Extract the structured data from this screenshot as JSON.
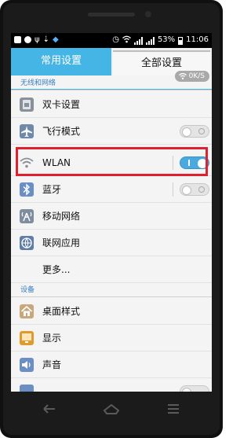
{
  "status_bar": {
    "battery": "53%",
    "time": "11:06",
    "left_icons": [
      "message-icon",
      "camera-icon",
      "usb-icon",
      "download-icon",
      "shield-icon"
    ],
    "right_icons": [
      "alarm-icon",
      "wifi-icon",
      "signal-icon",
      "signal-icon",
      "battery-icon"
    ]
  },
  "tabs": [
    {
      "label": "常用设置",
      "active": true
    },
    {
      "label": "全部设置",
      "active": false
    }
  ],
  "speed_badge": "0K/S",
  "sections": {
    "wireless": "无线和网络",
    "device": "设备"
  },
  "rows": {
    "dual_sim": {
      "label": "双卡设置",
      "icon": "sim-card-icon"
    },
    "airplane": {
      "label": "飞行模式",
      "icon": "airplane-icon",
      "toggle": false
    },
    "wlan": {
      "label": "WLAN",
      "icon": "wifi-icon",
      "toggle": true
    },
    "bluetooth": {
      "label": "蓝牙",
      "icon": "bluetooth-icon",
      "toggle": false
    },
    "mobile": {
      "label": "移动网络",
      "icon": "antenna-icon"
    },
    "net_apps": {
      "label": "联网应用",
      "icon": "globe-icon"
    },
    "more": {
      "label": "更多..."
    },
    "desktop": {
      "label": "桌面样式",
      "icon": "home-icon"
    },
    "display": {
      "label": "显示",
      "icon": "display-icon"
    },
    "sound": {
      "label": "声音",
      "icon": "speaker-icon"
    }
  },
  "colors": {
    "accent": "#45b5e6",
    "highlight": "#e0202e",
    "toggle_on": "#4aa9df"
  }
}
